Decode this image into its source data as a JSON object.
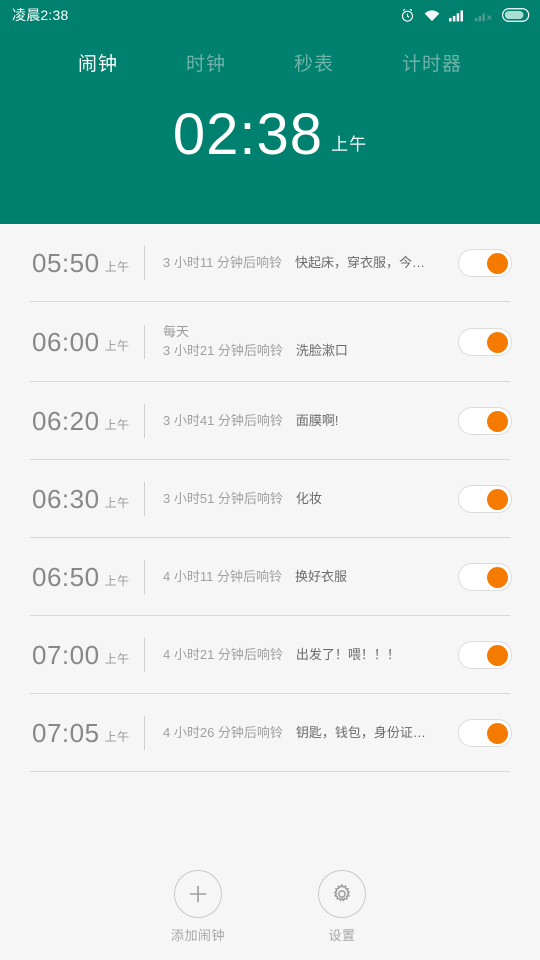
{
  "statusbar": {
    "time": "凌晨2:38",
    "icons": [
      "alarm-icon",
      "wifi-icon",
      "signal-icon",
      "signal-off-icon",
      "battery-icon"
    ]
  },
  "tabs": [
    {
      "label": "闹钟",
      "active": true
    },
    {
      "label": "时钟",
      "active": false
    },
    {
      "label": "秒表",
      "active": false
    },
    {
      "label": "计时器",
      "active": false
    }
  ],
  "clock": {
    "time": "02:38",
    "ampm": "上午"
  },
  "alarms": [
    {
      "time": "05:50",
      "ampm": "上午",
      "repeat": "",
      "ring": "3 小时11 分钟后响铃",
      "label": "快起床，穿衣服，今…",
      "enabled": true
    },
    {
      "time": "06:00",
      "ampm": "上午",
      "repeat": "每天",
      "ring": "3 小时21 分钟后响铃",
      "label": "洗脸漱口",
      "enabled": true
    },
    {
      "time": "06:20",
      "ampm": "上午",
      "repeat": "",
      "ring": "3 小时41 分钟后响铃",
      "label": "面膜啊!",
      "enabled": true
    },
    {
      "time": "06:30",
      "ampm": "上午",
      "repeat": "",
      "ring": "3 小时51 分钟后响铃",
      "label": "化妆",
      "enabled": true
    },
    {
      "time": "06:50",
      "ampm": "上午",
      "repeat": "",
      "ring": "4 小时11 分钟后响铃",
      "label": "换好衣服",
      "enabled": true
    },
    {
      "time": "07:00",
      "ampm": "上午",
      "repeat": "",
      "ring": "4 小时21 分钟后响铃",
      "label": "出发了！喂！！！",
      "enabled": true
    },
    {
      "time": "07:05",
      "ampm": "上午",
      "repeat": "",
      "ring": "4 小时26 分钟后响铃",
      "label": "钥匙，钱包，身份证…",
      "enabled": true
    }
  ],
  "bottom": {
    "add": {
      "label": "添加闹钟",
      "icon": "plus-icon"
    },
    "settings": {
      "label": "设置",
      "icon": "gear-icon"
    }
  },
  "colors": {
    "header_bg": "#00806e",
    "accent": "#f47a00",
    "body_bg": "#f6f6f6",
    "tab_active": "#ffffff",
    "tab_inactive": "#6fb3a8"
  }
}
